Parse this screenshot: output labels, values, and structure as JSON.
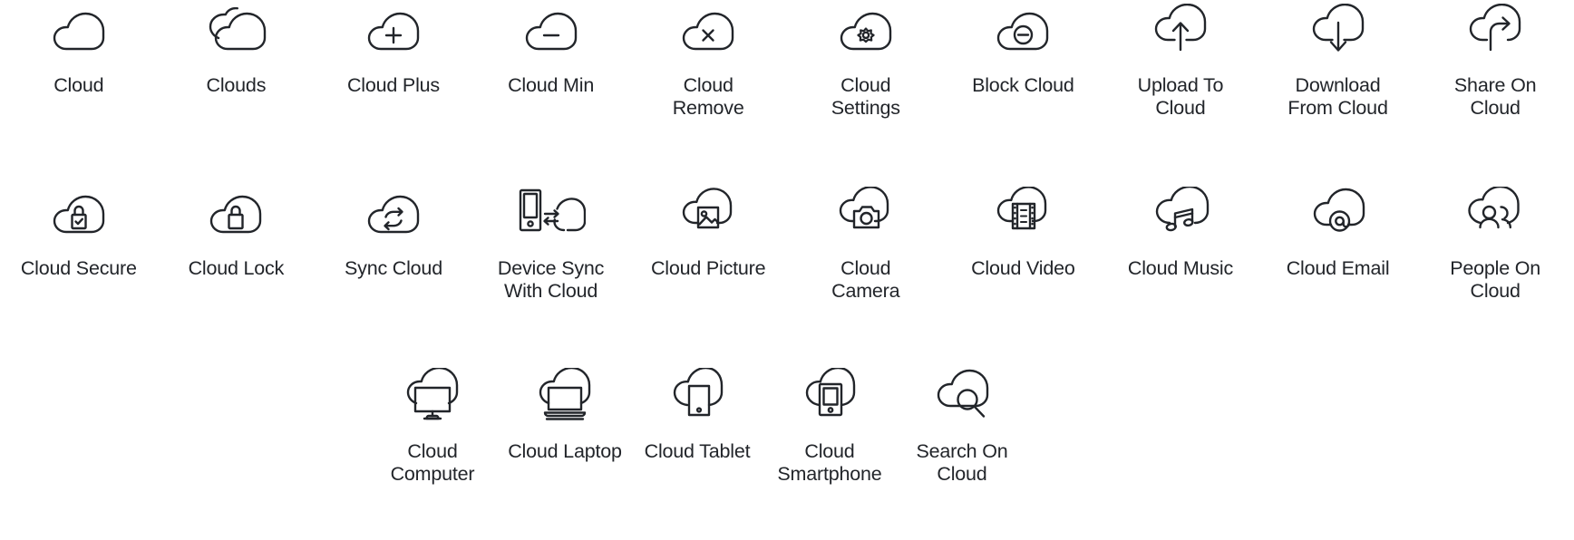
{
  "page": {
    "kind": "icon-reference-sheet",
    "background_color": "#ffffff",
    "stroke_color": "#22252a",
    "label_color": "#22252a"
  },
  "rows": [
    {
      "id": "row-1",
      "icons": [
        {
          "label": "Cloud",
          "icon": "cloud-icon"
        },
        {
          "label": "Clouds",
          "icon": "clouds-icon"
        },
        {
          "label": "Cloud Plus",
          "icon": "cloud-plus-icon"
        },
        {
          "label": "Cloud Min",
          "icon": "cloud-minus-icon"
        },
        {
          "label": "Cloud\nRemove",
          "icon": "cloud-remove-icon"
        },
        {
          "label": "Cloud\nSettings",
          "icon": "cloud-settings-icon"
        },
        {
          "label": "Block Cloud",
          "icon": "block-cloud-icon"
        },
        {
          "label": "Upload To\nCloud",
          "icon": "upload-to-cloud-icon"
        },
        {
          "label": "Download\nFrom Cloud",
          "icon": "download-from-cloud-icon"
        },
        {
          "label": "Share On\nCloud",
          "icon": "share-on-cloud-icon"
        }
      ]
    },
    {
      "id": "row-2",
      "icons": [
        {
          "label": "Cloud Secure",
          "icon": "cloud-secure-icon"
        },
        {
          "label": "Cloud Lock",
          "icon": "cloud-lock-icon"
        },
        {
          "label": "Sync Cloud",
          "icon": "sync-cloud-icon"
        },
        {
          "label": "Device Sync\nWith Cloud",
          "icon": "device-sync-with-cloud-icon"
        },
        {
          "label": "Cloud Picture",
          "icon": "cloud-picture-icon"
        },
        {
          "label": "Cloud\nCamera",
          "icon": "cloud-camera-icon"
        },
        {
          "label": "Cloud Video",
          "icon": "cloud-video-icon"
        },
        {
          "label": "Cloud Music",
          "icon": "cloud-music-icon"
        },
        {
          "label": "Cloud Email",
          "icon": "cloud-email-icon"
        },
        {
          "label": "People On\nCloud",
          "icon": "people-on-cloud-icon"
        }
      ]
    },
    {
      "id": "row-3",
      "icons": [
        {
          "label": "Cloud\nComputer",
          "icon": "cloud-computer-icon"
        },
        {
          "label": "Cloud Laptop",
          "icon": "cloud-laptop-icon"
        },
        {
          "label": "Cloud Tablet",
          "icon": "cloud-tablet-icon"
        },
        {
          "label": "Cloud\nSmartphone",
          "icon": "cloud-smartphone-icon"
        },
        {
          "label": "Search On\nCloud",
          "icon": "search-on-cloud-icon"
        }
      ]
    }
  ]
}
